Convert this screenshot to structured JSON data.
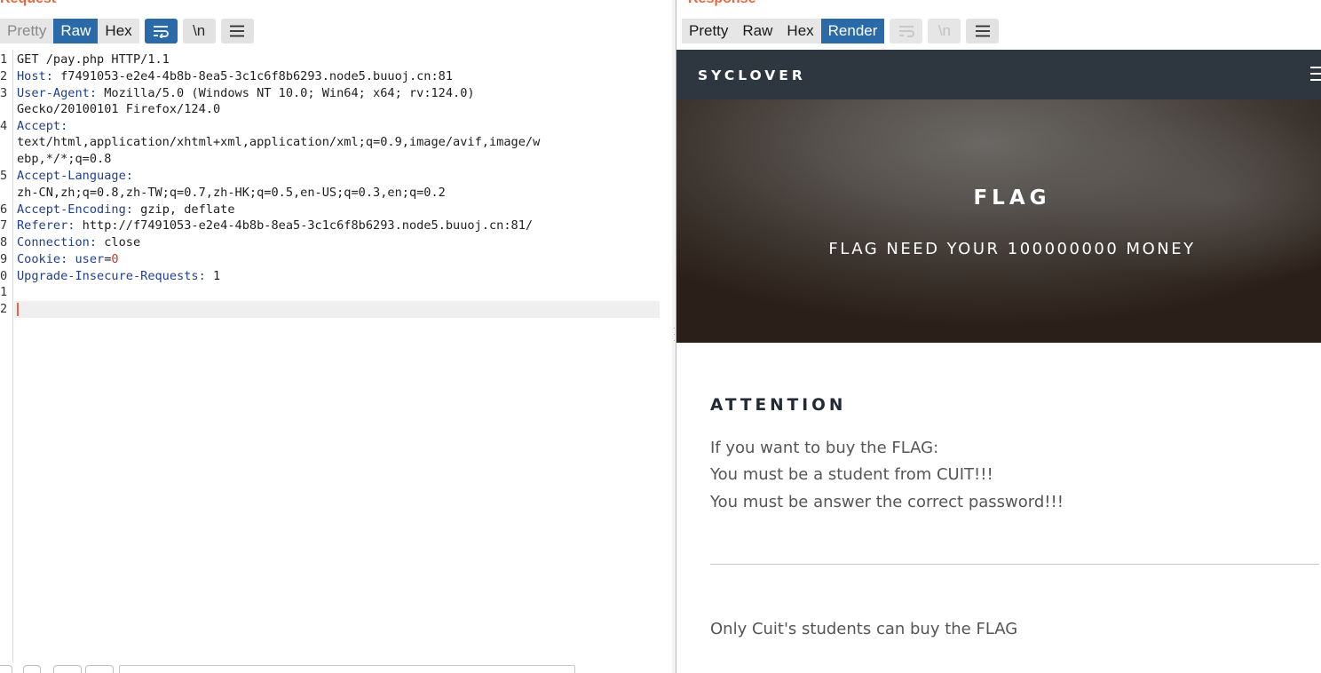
{
  "request": {
    "heading": "Request",
    "tabs": [
      "Pretty",
      "Raw",
      "Hex"
    ],
    "active_tab": "Raw",
    "buttons": {
      "wrap_icon": "wrap-lines-icon",
      "newline_label": "\\n",
      "menu_icon": "hamburger-menu-icon"
    },
    "lines": [
      {
        "n": "1",
        "text": "GET /pay.php HTTP/1.1"
      },
      {
        "n": "2",
        "key": "Host:",
        "val": " f7491053-e2e4-4b8b-8ea5-3c1c6f8b6293.node5.buuoj.cn:81"
      },
      {
        "n": "3",
        "key": "User-Agent:",
        "val": " Mozilla/5.0 (Windows NT 10.0; Win64; x64; rv:124.0)"
      },
      {
        "n": "",
        "text": "Gecko/20100101 Firefox/124.0"
      },
      {
        "n": "4",
        "key": "Accept:",
        "val": ""
      },
      {
        "n": "",
        "text": "text/html,application/xhtml+xml,application/xml;q=0.9,image/avif,image/w"
      },
      {
        "n": "",
        "text": "ebp,*/*;q=0.8"
      },
      {
        "n": "5",
        "key": "Accept-Language:",
        "val": ""
      },
      {
        "n": "",
        "text": "zh-CN,zh;q=0.8,zh-TW;q=0.7,zh-HK;q=0.5,en-US;q=0.3,en;q=0.2"
      },
      {
        "n": "6",
        "key": "Accept-Encoding:",
        "val": " gzip, deflate"
      },
      {
        "n": "7",
        "key": "Referer:",
        "val": " http://f7491053-e2e4-4b8b-8ea5-3c1c6f8b6293.node5.buuoj.cn:81/"
      },
      {
        "n": "8",
        "key": "Connection:",
        "val": " close"
      },
      {
        "n": "9",
        "key": "Cookie:",
        "cookie_name": " user",
        "cookie_eq": "=",
        "cookie_val": "0"
      },
      {
        "n": "0",
        "key": "Upgrade-Insecure-Requests:",
        "val": " 1"
      },
      {
        "n": "1",
        "text": ""
      },
      {
        "n": "2",
        "text": ""
      }
    ]
  },
  "response": {
    "heading": "Response",
    "tabs": [
      "Pretty",
      "Raw",
      "Hex",
      "Render"
    ],
    "active_tab": "Render",
    "buttons": {
      "wrap_icon": "wrap-lines-icon",
      "newline_label": "\\n",
      "menu_icon": "hamburger-menu-icon"
    },
    "site": {
      "brand": "SYCLOVER",
      "hero_title": "FLAG",
      "hero_subtitle": "FLAG NEED YOUR 100000000 MONEY",
      "attention_title": "ATTENTION",
      "attention_lines": [
        "If you want to buy the FLAG:",
        "You must be a student from CUIT!!!",
        "You must be answer the correct password!!!"
      ],
      "footer_note": "Only Cuit's students can buy the FLAG"
    }
  },
  "colors": {
    "accent": "#2b6aa8",
    "heading": "#e8663d",
    "header_key": "#1f3f8f",
    "cookie_value": "#d1352f",
    "site_nav": "#2e3640"
  }
}
